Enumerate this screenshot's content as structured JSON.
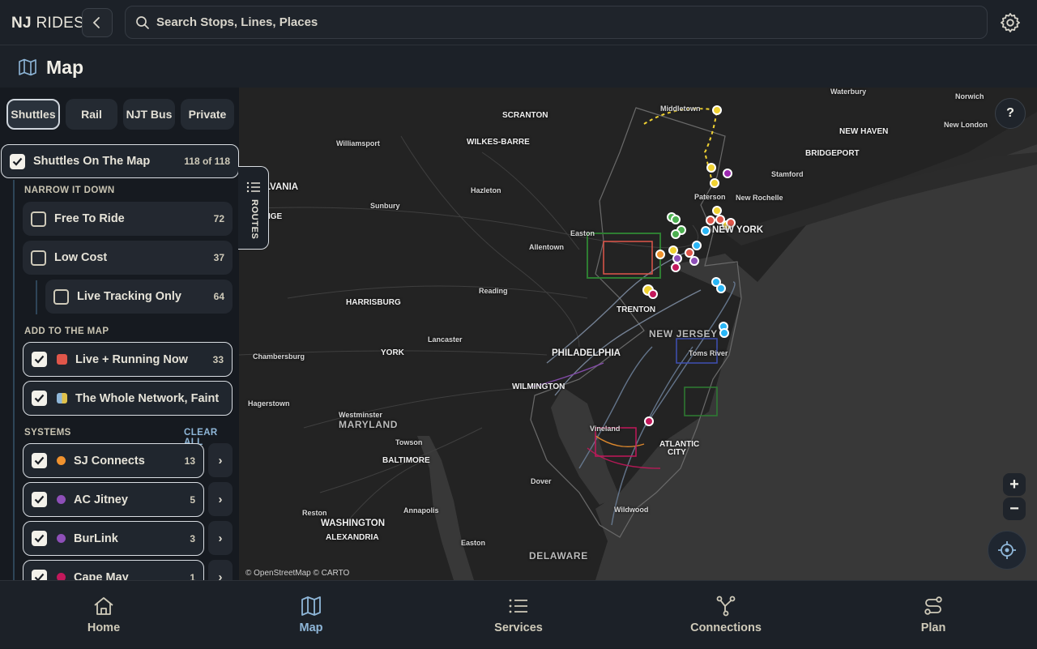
{
  "app": {
    "logo_bold": "NJ",
    "logo_rest": "RIDES",
    "search_placeholder": "Search Stops, Lines, Places",
    "page_title": "Map"
  },
  "tabs": [
    {
      "label": "Shuttles",
      "active": true
    },
    {
      "label": "Rail",
      "active": false
    },
    {
      "label": "NJT Bus",
      "active": false
    },
    {
      "label": "Private",
      "active": false
    }
  ],
  "sidebar": {
    "shuttles_on_map": {
      "label": "Shuttles On The Map",
      "count": "118 of 118",
      "checked": true
    },
    "narrow_heading": "NARROW IT DOWN",
    "narrow": [
      {
        "label": "Free To Ride",
        "count": "72",
        "checked": false
      },
      {
        "label": "Low Cost",
        "count": "37",
        "checked": false
      },
      {
        "label": "Live Tracking Only",
        "count": "64",
        "checked": false
      }
    ],
    "add_heading": "ADD TO THE MAP",
    "add": [
      {
        "label": "Live + Running Now",
        "count": "33",
        "checked": true,
        "swatch": "#e0564a"
      },
      {
        "label": "The Whole Network, Faint",
        "count": "",
        "checked": true,
        "swatch": "#e0c14a"
      }
    ],
    "systems_heading": "SYSTEMS",
    "clear_all": "CLEAR ALL",
    "systems": [
      {
        "label": "SJ Connects",
        "count": "13",
        "checked": true,
        "color": "#f0922e"
      },
      {
        "label": "AC Jitney",
        "count": "5",
        "checked": true,
        "color": "#8e4fb8"
      },
      {
        "label": "BurLink",
        "count": "3",
        "checked": true,
        "color": "#8e4fb8"
      },
      {
        "label": "Cape May",
        "count": "1",
        "checked": true,
        "color": "#c2185b"
      }
    ],
    "chevron": "›"
  },
  "routes_tab": {
    "label": "ROUTES"
  },
  "map": {
    "labels": [
      {
        "text": "Waterbury",
        "size": "s"
      },
      {
        "text": "Norwich",
        "size": "s"
      },
      {
        "text": "Middletown",
        "size": "s"
      },
      {
        "text": "SCRANTON",
        "size": "m"
      },
      {
        "text": "NEW HAVEN",
        "size": "m"
      },
      {
        "text": "New London",
        "size": "s"
      },
      {
        "text": "Williamsport",
        "size": "s"
      },
      {
        "text": "WILKES-BARRE",
        "size": "m"
      },
      {
        "text": "BRIDGEPORT",
        "size": "m"
      },
      {
        "text": "Stamford",
        "size": "s"
      },
      {
        "text": "LVANIA",
        "size": "l"
      },
      {
        "text": "Hazleton",
        "size": "s"
      },
      {
        "text": "Paterson",
        "size": "s"
      },
      {
        "text": "New Rochelle",
        "size": "s"
      },
      {
        "text": "Sunbury",
        "size": "s"
      },
      {
        "text": "IGE",
        "size": "m"
      },
      {
        "text": "NEW YORK",
        "size": "l"
      },
      {
        "text": "Easton",
        "size": "s"
      },
      {
        "text": "Allentown",
        "size": "s"
      },
      {
        "text": "Reading",
        "size": "s"
      },
      {
        "text": "HARRISBURG",
        "size": "m"
      },
      {
        "text": "TRENTON",
        "size": "m"
      },
      {
        "text": "NEW JERSEY",
        "size": "xl"
      },
      {
        "text": "Lancaster",
        "size": "s"
      },
      {
        "text": "Chambersburg",
        "size": "s"
      },
      {
        "text": "YORK",
        "size": "m"
      },
      {
        "text": "PHILADELPHIA",
        "size": "l"
      },
      {
        "text": "Toms River",
        "size": "s"
      },
      {
        "text": "WILMINGTON",
        "size": "m"
      },
      {
        "text": "Hagerstown",
        "size": "s"
      },
      {
        "text": "Westminster",
        "size": "s"
      },
      {
        "text": "MARYLAND",
        "size": "xl"
      },
      {
        "text": "Vineland",
        "size": "s"
      },
      {
        "text": "ATLANTIC",
        "size": "m"
      },
      {
        "text": "CITY",
        "size": "m"
      },
      {
        "text": "Towson",
        "size": "s"
      },
      {
        "text": "BALTIMORE",
        "size": "m"
      },
      {
        "text": "Dover",
        "size": "s"
      },
      {
        "text": "Reston",
        "size": "s"
      },
      {
        "text": "Annapolis",
        "size": "s"
      },
      {
        "text": "Wildwood",
        "size": "s"
      },
      {
        "text": "WASHINGTON",
        "size": "l"
      },
      {
        "text": "ALEXANDRIA",
        "size": "m"
      },
      {
        "text": "Easton",
        "size": "s"
      },
      {
        "text": "DELAWARE",
        "size": "xl"
      }
    ],
    "attribution": "© OpenStreetMap © CARTO",
    "help": "?",
    "zoom_in": "+",
    "zoom_out": "−"
  },
  "bottom_nav": [
    {
      "label": "Home",
      "icon": "home-icon",
      "active": false
    },
    {
      "label": "Map",
      "icon": "map-icon",
      "active": true
    },
    {
      "label": "Services",
      "icon": "list-icon",
      "active": false
    },
    {
      "label": "Connections",
      "icon": "connections-icon",
      "active": false
    },
    {
      "label": "Plan",
      "icon": "route-plan-icon",
      "active": false
    }
  ],
  "colors": {
    "accent": "#8fb7d9",
    "background": "#1c2128",
    "map_land": "#232323",
    "map_water": "#3a3a3a"
  }
}
